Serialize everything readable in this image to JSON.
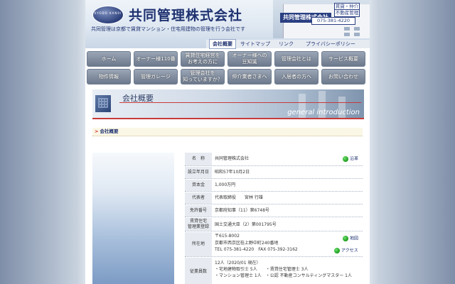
{
  "header": {
    "logo_mark": "KYODO KANRI",
    "company_name": "共同管理株式会社",
    "tagline": "共同管理は京都で賃貸マンション・住宅用建物の管理を行う会社です",
    "sign_name": "共同管理株式会社",
    "sign_sub1": "賃貸・仲介",
    "sign_sub2": "不動産管理",
    "sign_tel": "075-381-4220"
  },
  "top_nav": {
    "items": [
      "会社概要",
      "サイトマップ",
      "リンク",
      "プライバシーポリシー"
    ],
    "selected": "会社概要"
  },
  "main_nav": {
    "row1": [
      "ホーム",
      "オーナー様110番",
      "賃貸住宅経営を\nお考えの方に",
      "オーナー様への\n豆知識",
      "管理会社とは",
      "サービス概要"
    ],
    "row2": [
      "物件情報",
      "管理ガレージ",
      "管理会社を\n知っていますか？",
      "仲介業者さまへ",
      "入居者の方へ",
      "お問い合わせ"
    ]
  },
  "banner": {
    "title": "会社概要",
    "subtitle": "general introduction"
  },
  "breadcrumb": {
    "arrow": ">",
    "label": "会社概要"
  },
  "info_table": [
    {
      "label": "名　称",
      "value": "共同管理株式会社",
      "link": "沿革"
    },
    {
      "label": "設立年月日",
      "value": "昭和57年10月2日"
    },
    {
      "label": "資本金",
      "value": "1,000万円"
    },
    {
      "label": "代表者",
      "value": "代表取締役　　宮林 行雄"
    },
    {
      "label": "免許番号",
      "value": "京都府知事（11）第6748号"
    },
    {
      "label": "賃貸住宅\n管理業登録",
      "value": "国土交通大臣（2）第001795号"
    },
    {
      "label": "所在地",
      "lines": [
        "〒615-8002",
        "京都市西京区桂上野中町240番地",
        "TEL 075-381-4220　FAX 075-392-3162"
      ],
      "links": [
        "地図",
        "アクセス"
      ]
    },
    {
      "label": "従業員数",
      "lines": [
        "12人（2020/01 現在）",
        "・宅地建物取引士 5人　　・賃貸住宅管理士 3人",
        "・マンション管理士 1人　・公認 不動産コンサルティングマスター 1人"
      ]
    }
  ]
}
